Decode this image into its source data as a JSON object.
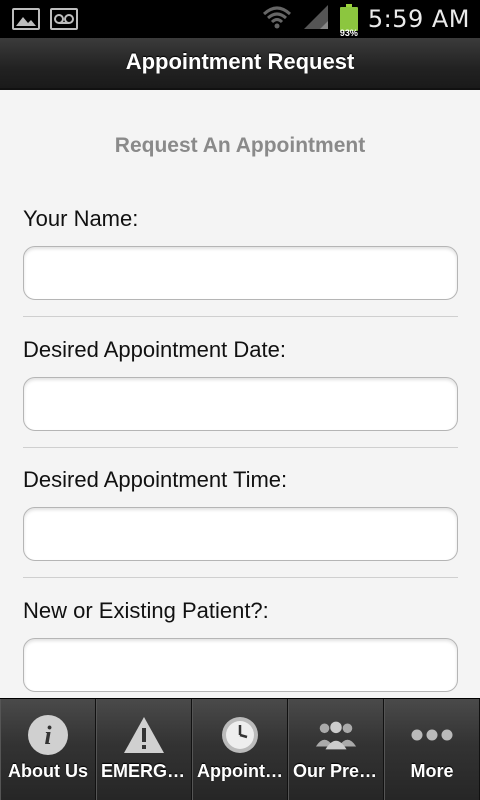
{
  "status_bar": {
    "time": "5:59 AM",
    "battery_percent": "93%",
    "icons": [
      "image-notification-icon",
      "voicemail-icon",
      "wifi-icon",
      "signal-icon",
      "battery-icon"
    ]
  },
  "header": {
    "title": "Appointment Request"
  },
  "form": {
    "heading": "Request An Appointment",
    "fields": [
      {
        "label": "Your Name:",
        "value": ""
      },
      {
        "label": "Desired Appointment Date:",
        "value": ""
      },
      {
        "label": "Desired Appointment Time:",
        "value": ""
      },
      {
        "label": "New or Existing Patient?:",
        "value": ""
      }
    ]
  },
  "tabs": [
    {
      "label": "About Us",
      "icon": "info-icon"
    },
    {
      "label": "EMERGE…",
      "icon": "warning-icon"
    },
    {
      "label": "Appoint…",
      "icon": "clock-icon"
    },
    {
      "label": "Our Pref…",
      "icon": "people-icon"
    },
    {
      "label": "More",
      "icon": "more-dots-icon"
    }
  ],
  "colors": {
    "header_bg": "#222222",
    "page_bg": "#f4f4f4",
    "heading_text": "#8a8a8a",
    "battery": "#8cc63f"
  }
}
